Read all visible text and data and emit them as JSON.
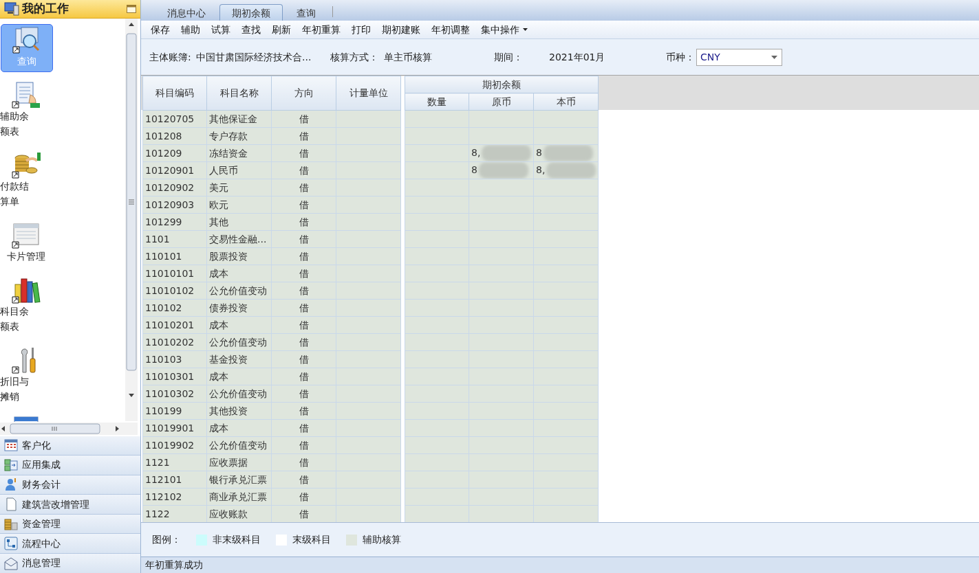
{
  "sidebar": {
    "title": "我的工作",
    "items": [
      {
        "label": "查询",
        "kind": "query",
        "selected": true
      },
      {
        "label": "辅助余额表",
        "kind": "doc",
        "selected": false
      },
      {
        "label": "付款结算单",
        "kind": "coins",
        "selected": false
      },
      {
        "label": "卡片管理",
        "kind": "card",
        "selected": false
      },
      {
        "label": "科目余额表",
        "kind": "books",
        "selected": false
      },
      {
        "label": "折旧与摊销",
        "kind": "tools",
        "selected": false
      },
      {
        "kind": "chart",
        "selected": false
      }
    ],
    "modules": [
      {
        "label": "客户化",
        "kind": "grid"
      },
      {
        "label": "应用集成",
        "kind": "plug"
      },
      {
        "label": "财务会计",
        "kind": "person"
      },
      {
        "label": "建筑营改增管理",
        "kind": "page"
      },
      {
        "label": "资金管理",
        "kind": "coins"
      },
      {
        "label": "流程中心",
        "kind": "flow"
      },
      {
        "label": "消息管理",
        "kind": "mail"
      }
    ]
  },
  "tabs": [
    {
      "label": "消息中心",
      "selected": false
    },
    {
      "label": "期初余额",
      "selected": true
    },
    {
      "label": "查询",
      "selected": false
    }
  ],
  "toolbar": [
    {
      "label": "保存"
    },
    {
      "label": "辅助"
    },
    {
      "label": "试算"
    },
    {
      "label": "查找"
    },
    {
      "label": "刷新"
    },
    {
      "label": "年初重算"
    },
    {
      "label": "打印"
    },
    {
      "label": "期初建账"
    },
    {
      "label": "年初调整"
    },
    {
      "label": "集中操作",
      "dropdown": true
    }
  ],
  "info": [
    {
      "label": "主体账簿:",
      "value": "中国甘肃国际经济技术合..."
    },
    {
      "label": "核算方式：",
      "value": "单主币核算"
    },
    {
      "label": "期间：",
      "value": "2021年01月"
    }
  ],
  "currency": {
    "label": "币种：",
    "value": "CNY"
  },
  "table": {
    "columns": [
      "科目编码",
      "科目名称",
      "方向",
      "计量单位"
    ],
    "group": "期初余额",
    "subcolumns": [
      "数量",
      "原币",
      "本币"
    ],
    "rows": [
      {
        "code": "10120705",
        "name": "其他保证金",
        "dir": "借"
      },
      {
        "code": "101208",
        "name": "专户存款",
        "dir": "借"
      },
      {
        "code": "101209",
        "name": "冻结资金",
        "dir": "借",
        "orig": "8,",
        "local": "8",
        "redacted": true
      },
      {
        "code": "10120901",
        "name": "人民币",
        "dir": "借",
        "orig": "8",
        "local": "8,",
        "redacted": true
      },
      {
        "code": "10120902",
        "name": "美元",
        "dir": "借"
      },
      {
        "code": "10120903",
        "name": "欧元",
        "dir": "借"
      },
      {
        "code": "101299",
        "name": "其他",
        "dir": "借"
      },
      {
        "code": "1101",
        "name": "交易性金融...",
        "dir": "借"
      },
      {
        "code": "110101",
        "name": "股票投资",
        "dir": "借"
      },
      {
        "code": "11010101",
        "name": "成本",
        "dir": "借"
      },
      {
        "code": "11010102",
        "name": "公允价值变动",
        "dir": "借"
      },
      {
        "code": "110102",
        "name": "债券投资",
        "dir": "借"
      },
      {
        "code": "11010201",
        "name": "成本",
        "dir": "借"
      },
      {
        "code": "11010202",
        "name": "公允价值变动",
        "dir": "借"
      },
      {
        "code": "110103",
        "name": "基金投资",
        "dir": "借"
      },
      {
        "code": "11010301",
        "name": "成本",
        "dir": "借"
      },
      {
        "code": "11010302",
        "name": "公允价值变动",
        "dir": "借"
      },
      {
        "code": "110199",
        "name": "其他投资",
        "dir": "借"
      },
      {
        "code": "11019901",
        "name": "成本",
        "dir": "借"
      },
      {
        "code": "11019902",
        "name": "公允价值变动",
        "dir": "借"
      },
      {
        "code": "1121",
        "name": "应收票据",
        "dir": "借"
      },
      {
        "code": "112101",
        "name": "银行承兑汇票",
        "dir": "借"
      },
      {
        "code": "112102",
        "name": "商业承兑汇票",
        "dir": "借"
      },
      {
        "code": "1122",
        "name": "应收账款",
        "dir": "借"
      }
    ]
  },
  "legend": {
    "label": "图例：",
    "items": [
      {
        "label": "非末级科目",
        "color": "#ccfcfc"
      },
      {
        "label": "末级科目",
        "color": "#ffffff"
      },
      {
        "label": "辅助核算",
        "color": "#dfe6dd"
      }
    ]
  },
  "status_bar": "年初重算成功"
}
